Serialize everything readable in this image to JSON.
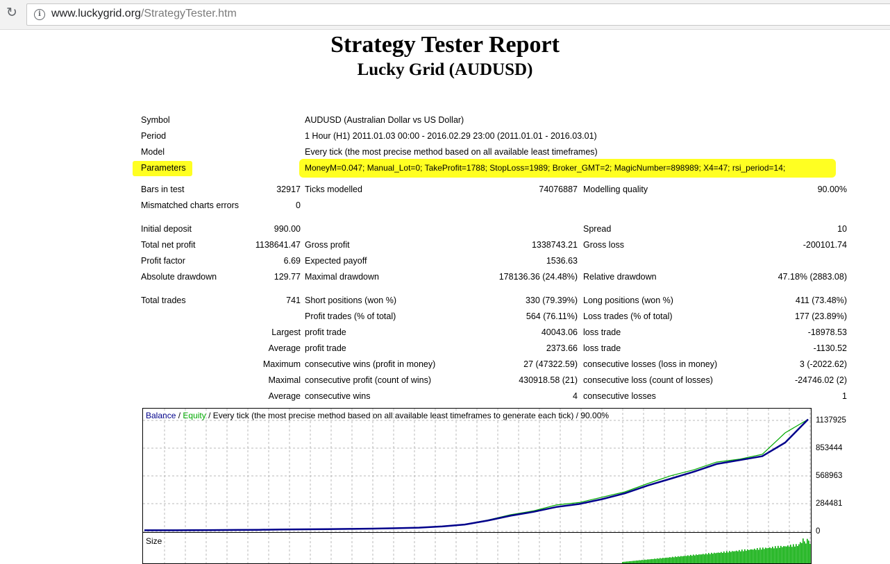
{
  "browser": {
    "url_host": "www.luckygrid.org",
    "url_path": "/StrategyTester.htm"
  },
  "report": {
    "title": "Strategy Tester Report",
    "subtitle": "Lucky Grid (AUDUSD)"
  },
  "info": {
    "symbol_label": "Symbol",
    "symbol_value": "AUDUSD (Australian Dollar vs US Dollar)",
    "period_label": "Period",
    "period_value": "1 Hour (H1) 2011.01.03 00:00 - 2016.02.29 23:00 (2011.01.01 - 2016.03.01)",
    "model_label": "Model",
    "model_value": "Every tick (the most precise method based on all available least timeframes)",
    "parameters_label": "Parameters",
    "parameters_value": "MoneyM=0.047; Manual_Lot=0; TakeProfit=1788; StopLoss=1989; Broker_GMT=2; MagicNumber=898989; X4=47; rsi_period=14;",
    "highlight_color": "#ffff22"
  },
  "stats": {
    "bars_label": "Bars in test",
    "bars_value": "32917",
    "ticks_label": "Ticks modelled",
    "ticks_value": "74076887",
    "quality_label": "Modelling quality",
    "quality_value": "90.00%",
    "mismatch_label": "Mismatched charts errors",
    "mismatch_value": "0",
    "deposit_label": "Initial deposit",
    "deposit_value": "990.00",
    "spread_label": "Spread",
    "spread_value": "10",
    "netprofit_label": "Total net profit",
    "netprofit_value": "1138641.47",
    "grossprofit_label": "Gross profit",
    "grossprofit_value": "1338743.21",
    "grossloss_label": "Gross loss",
    "grossloss_value": "-200101.74",
    "pf_label": "Profit factor",
    "pf_value": "6.69",
    "payoff_label": "Expected payoff",
    "payoff_value": "1536.63",
    "absdd_label": "Absolute drawdown",
    "absdd_value": "129.77",
    "maxdd_label": "Maximal drawdown",
    "maxdd_value": "178136.36 (24.48%)",
    "reldd_label": "Relative drawdown",
    "reldd_value": "47.18% (2883.08)",
    "trades_label": "Total trades",
    "trades_value": "741",
    "short_label": "Short positions (won %)",
    "short_value": "330 (79.39%)",
    "long_label": "Long positions (won %)",
    "long_value": "411 (73.48%)",
    "ptrades_label": "Profit trades (% of total)",
    "ptrades_value": "564 (76.11%)",
    "ltrades_label": "Loss trades (% of total)",
    "ltrades_value": "177 (23.89%)",
    "largest_label": "Largest",
    "largest_profit_label": "profit trade",
    "largest_profit_value": "40043.06",
    "largest_loss_label": "loss trade",
    "largest_loss_value": "-18978.53",
    "average_label": "Average",
    "average_profit_label": "profit trade",
    "average_profit_value": "2373.66",
    "average_loss_label": "loss trade",
    "average_loss_value": "-1130.52",
    "maximum_label": "Maximum",
    "max_wins_label": "consecutive wins (profit in money)",
    "max_wins_value": "27 (47322.59)",
    "max_losses_label": "consecutive losses (loss in money)",
    "max_losses_value": "3 (-2022.62)",
    "maximal_label": "Maximal",
    "maximal_profit_label": "consecutive profit (count of wins)",
    "maximal_profit_value": "430918.58 (21)",
    "maximal_loss_label": "consecutive loss (count of losses)",
    "maximal_loss_value": "-24746.02 (2)",
    "avg2_label": "Average",
    "avg_wins_label": "consecutive wins",
    "avg_wins_value": "4",
    "avg_losses_label": "consecutive losses",
    "avg_losses_value": "1"
  },
  "chart": {
    "legend_balance": "Balance",
    "legend_sep1": " / ",
    "legend_equity": "Equity",
    "legend_rest": " / Every tick (the most precise method based on all available least timeframes to generate each tick) / 90.00%",
    "size_label": "Size",
    "balance_color": "#00008b",
    "equity_color": "#00aa00"
  },
  "chart_data": {
    "type": "line",
    "ylim": [
      0,
      1137925
    ],
    "yticks": [
      "1137925",
      "853444",
      "568963",
      "284481",
      "0"
    ],
    "grid": true,
    "series": [
      {
        "name": "Balance",
        "values": [
          990,
          990,
          1500,
          2500,
          4000,
          6000,
          9000,
          11000,
          13000,
          15000,
          18000,
          22000,
          28000,
          40000,
          60000,
          100000,
          150000,
          190000,
          240000,
          270000,
          320000,
          380000,
          460000,
          530000,
          600000,
          680000,
          720000,
          760000,
          900000,
          1137925
        ]
      },
      {
        "name": "Equity",
        "values": [
          990,
          990,
          1500,
          2500,
          4000,
          6000,
          9000,
          11000,
          13000,
          15000,
          18000,
          22000,
          28000,
          42000,
          62000,
          105000,
          160000,
          200000,
          260000,
          285000,
          340000,
          395000,
          480000,
          560000,
          620000,
          700000,
          730000,
          780000,
          1000000,
          1137925
        ]
      }
    ]
  }
}
